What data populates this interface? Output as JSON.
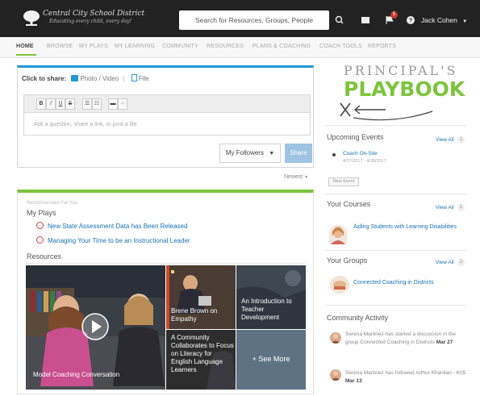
{
  "header": {
    "logo_name": "Central City School District",
    "logo_tagline": "Educating every child, every day!",
    "search_placeholder": "Search for Resources, Groups, People",
    "notification_count": "5",
    "user_name": "Jack Cohen"
  },
  "nav": {
    "items": [
      "HOME",
      "BROWSE",
      "MY PLAYS",
      "MY LEARNING",
      "COMMUNITY",
      "RESOURCES",
      "PLANS & COACHING",
      "COACH TOOLS",
      "REPORTS"
    ]
  },
  "share": {
    "label": "Click to share:",
    "photo_video": "Photo / Video",
    "separator": "|",
    "file": "File",
    "toolbar": [
      "B",
      "I",
      "U",
      "S"
    ],
    "placeholder": "Ask a question, share a link, or post a file",
    "audience": "My Followers",
    "share_button": "Share"
  },
  "feed": {
    "sort": "Newest",
    "recommended_label": "Recommended For You",
    "my_plays_title": "My Plays",
    "plays": [
      "New State Assessment Data has Been Released",
      "Managing Your Time to be an Instructional Leader"
    ],
    "resources_title": "Resources",
    "resources": [
      {
        "caption": "Model Coaching Conversation"
      },
      {
        "caption": "Brene Brown on Empathy"
      },
      {
        "caption": "An Introduction to Teacher Development"
      },
      {
        "caption": "A Community Collaborates to Focus on Literacy for English Language Learners"
      },
      {
        "caption": "+ See More"
      }
    ],
    "colors": {
      "green": "#7cc43c",
      "blue": "#1e9ad6",
      "link": "#1a73b5"
    }
  },
  "sidebar": {
    "brand_top": "PRINCIPAL'S",
    "brand_bottom": "PLAYBOOK",
    "events": {
      "title": "Upcoming Events",
      "view_all": "View All",
      "count": "1",
      "items": [
        {
          "name": "Coach On-Site",
          "date": "4/27/2017 - 4/28/2017"
        }
      ],
      "new_event": "New Event"
    },
    "courses": {
      "title": "Your Courses",
      "view_all": "View All",
      "count": "1",
      "items": [
        "Aiding Students with Learning Disabilities"
      ]
    },
    "groups": {
      "title": "Your Groups",
      "view_all": "View All",
      "count": "2",
      "items": [
        "Connected Coaching in Districts"
      ]
    },
    "activity": {
      "title": "Community Activity",
      "items": [
        {
          "text": "Serena Martinez has started a discussion in the group Connected Coaching in Districts",
          "date": "Mar 27"
        },
        {
          "text": "Serena Martinez has followed Arthur Khanlian - K05",
          "date": "Mar 13"
        }
      ]
    }
  }
}
